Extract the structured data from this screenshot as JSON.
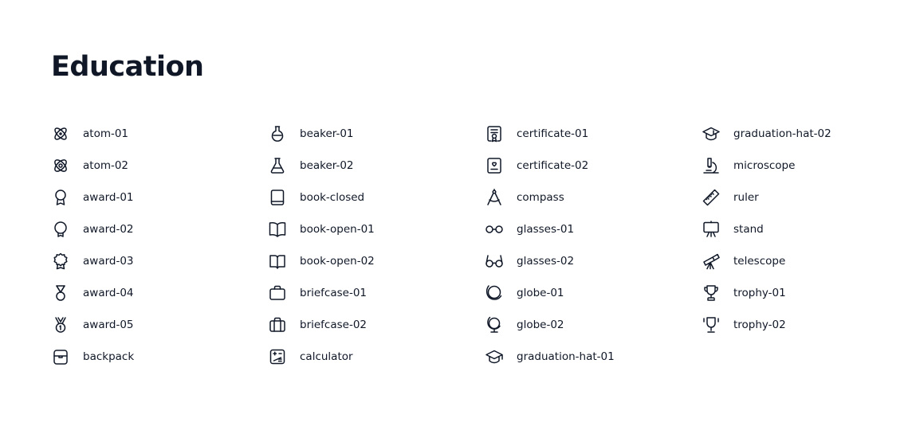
{
  "title": "Education",
  "columns": [
    [
      {
        "label": "atom-01",
        "icon": "atom-01-icon"
      },
      {
        "label": "atom-02",
        "icon": "atom-02-icon"
      },
      {
        "label": "award-01",
        "icon": "award-01-icon"
      },
      {
        "label": "award-02",
        "icon": "award-02-icon"
      },
      {
        "label": "award-03",
        "icon": "award-03-icon"
      },
      {
        "label": "award-04",
        "icon": "award-04-icon"
      },
      {
        "label": "award-05",
        "icon": "award-05-icon"
      },
      {
        "label": "backpack",
        "icon": "backpack-icon"
      }
    ],
    [
      {
        "label": "beaker-01",
        "icon": "beaker-01-icon"
      },
      {
        "label": "beaker-02",
        "icon": "beaker-02-icon"
      },
      {
        "label": "book-closed",
        "icon": "book-closed-icon"
      },
      {
        "label": "book-open-01",
        "icon": "book-open-01-icon"
      },
      {
        "label": "book-open-02",
        "icon": "book-open-02-icon"
      },
      {
        "label": "briefcase-01",
        "icon": "briefcase-01-icon"
      },
      {
        "label": "briefcase-02",
        "icon": "briefcase-02-icon"
      },
      {
        "label": "calculator",
        "icon": "calculator-icon"
      }
    ],
    [
      {
        "label": "certificate-01",
        "icon": "certificate-01-icon"
      },
      {
        "label": "certificate-02",
        "icon": "certificate-02-icon"
      },
      {
        "label": "compass",
        "icon": "compass-icon"
      },
      {
        "label": "glasses-01",
        "icon": "glasses-01-icon"
      },
      {
        "label": "glasses-02",
        "icon": "glasses-02-icon"
      },
      {
        "label": "globe-01",
        "icon": "globe-01-icon"
      },
      {
        "label": "globe-02",
        "icon": "globe-02-icon"
      },
      {
        "label": "graduation-hat-01",
        "icon": "graduation-hat-01-icon"
      }
    ],
    [
      {
        "label": "graduation-hat-02",
        "icon": "graduation-hat-02-icon"
      },
      {
        "label": "microscope",
        "icon": "microscope-icon"
      },
      {
        "label": "ruler",
        "icon": "ruler-icon"
      },
      {
        "label": "stand",
        "icon": "stand-icon"
      },
      {
        "label": "telescope",
        "icon": "telescope-icon"
      },
      {
        "label": "trophy-01",
        "icon": "trophy-01-icon"
      },
      {
        "label": "trophy-02",
        "icon": "trophy-02-icon"
      }
    ]
  ]
}
